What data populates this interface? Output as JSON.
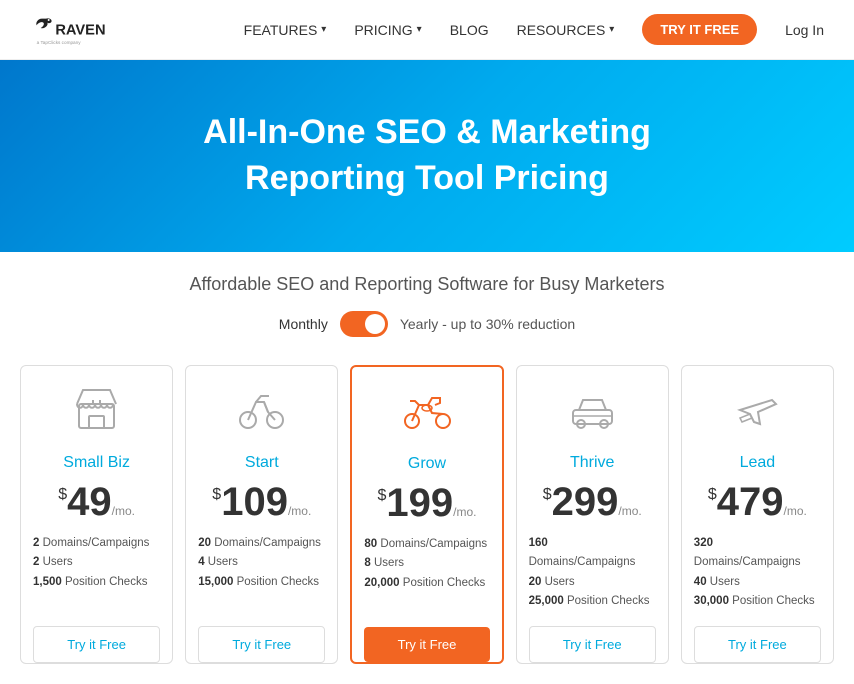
{
  "nav": {
    "logo_alt": "Raven",
    "tagline": "a TapClicks company",
    "links": [
      {
        "label": "FEATURES",
        "hasArrow": true
      },
      {
        "label": "PRICING",
        "hasArrow": true
      },
      {
        "label": "BLOG",
        "hasArrow": false
      },
      {
        "label": "RESOURCES",
        "hasArrow": true
      }
    ],
    "cta": "TRY IT FREE",
    "login": "Log In"
  },
  "hero": {
    "title_line1": "All-In-One SEO & Marketing",
    "title_line2": "Reporting Tool Pricing"
  },
  "subtitle": "Affordable SEO and Reporting Software for Busy Marketers",
  "toggle": {
    "monthly_label": "Monthly",
    "yearly_label": "Yearly - up to 30% reduction"
  },
  "plans": [
    {
      "id": "small-biz",
      "name": "Small Biz",
      "icon_type": "store",
      "dollar": "$",
      "price": "49",
      "period": "/mo.",
      "domains": "2",
      "users": "2",
      "position_checks": "1,500",
      "cta": "Try it Free",
      "featured": false
    },
    {
      "id": "start",
      "name": "Start",
      "icon_type": "bike",
      "dollar": "$",
      "price": "109",
      "period": "/mo.",
      "domains": "20",
      "users": "4",
      "position_checks": "15,000",
      "cta": "Try it Free",
      "featured": false
    },
    {
      "id": "grow",
      "name": "Grow",
      "icon_type": "moto",
      "dollar": "$",
      "price": "199",
      "period": "/mo.",
      "domains": "80",
      "users": "8",
      "position_checks": "20,000",
      "cta": "Try it Free",
      "featured": true
    },
    {
      "id": "thrive",
      "name": "Thrive",
      "icon_type": "car",
      "dollar": "$",
      "price": "299",
      "period": "/mo.",
      "domains": "160",
      "users": "20",
      "position_checks": "25,000",
      "cta": "Try it Free",
      "featured": false
    },
    {
      "id": "lead",
      "name": "Lead",
      "icon_type": "plane",
      "dollar": "$",
      "price": "479",
      "period": "/mo.",
      "domains": "320",
      "users": "40",
      "position_checks": "30,000",
      "cta": "Try it Free",
      "featured": false
    }
  ]
}
